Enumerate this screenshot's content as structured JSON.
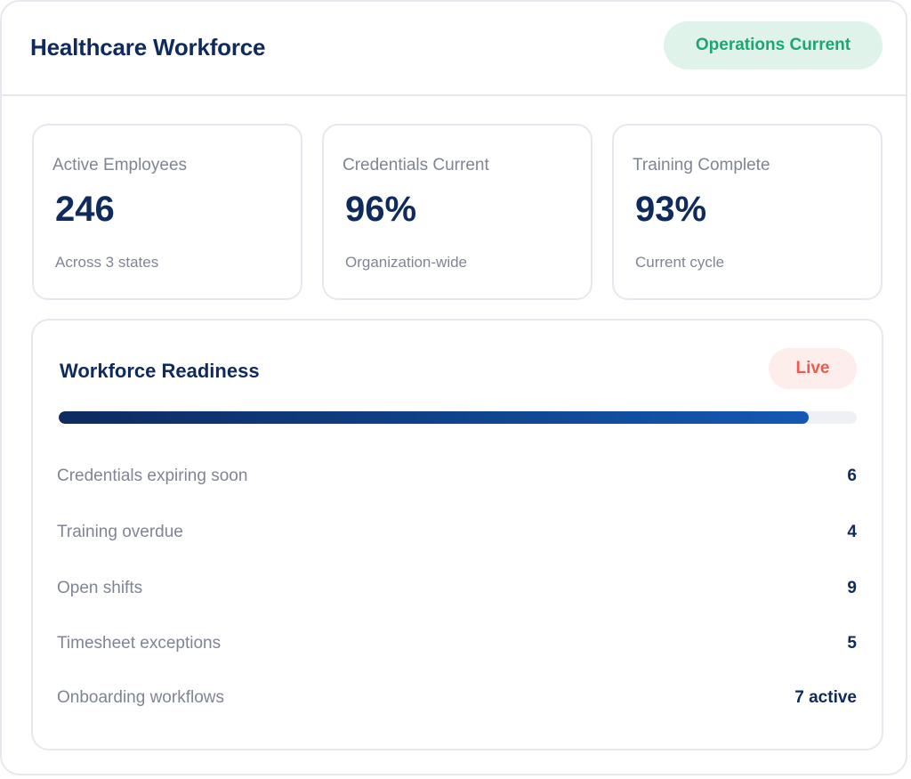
{
  "header": {
    "title": "Healthcare Workforce",
    "status": "Operations Current",
    "status_color": "#1ea672"
  },
  "stats": [
    {
      "label": "Active Employees",
      "value": "246",
      "sub": "Across 3 states"
    },
    {
      "label": "Credentials Current",
      "value": "96%",
      "sub": "Organization-wide"
    },
    {
      "label": "Training Complete",
      "value": "93%",
      "sub": "Current cycle"
    }
  ],
  "readiness": {
    "title": "Workforce Readiness",
    "badge": "Live",
    "badge_color": "#ee5a4c",
    "progress_percent": 94,
    "metrics": [
      {
        "label": "Credentials expiring soon",
        "value": "6"
      },
      {
        "label": "Training overdue",
        "value": "4"
      },
      {
        "label": "Open shifts",
        "value": "9"
      },
      {
        "label": "Timesheet exceptions",
        "value": "5"
      },
      {
        "label": "Onboarding workflows",
        "value": "7 active"
      }
    ]
  },
  "colors": {
    "primary_text": "#0f2a5c",
    "muted_text": "#7f8594",
    "border": "#e6e8ef"
  }
}
